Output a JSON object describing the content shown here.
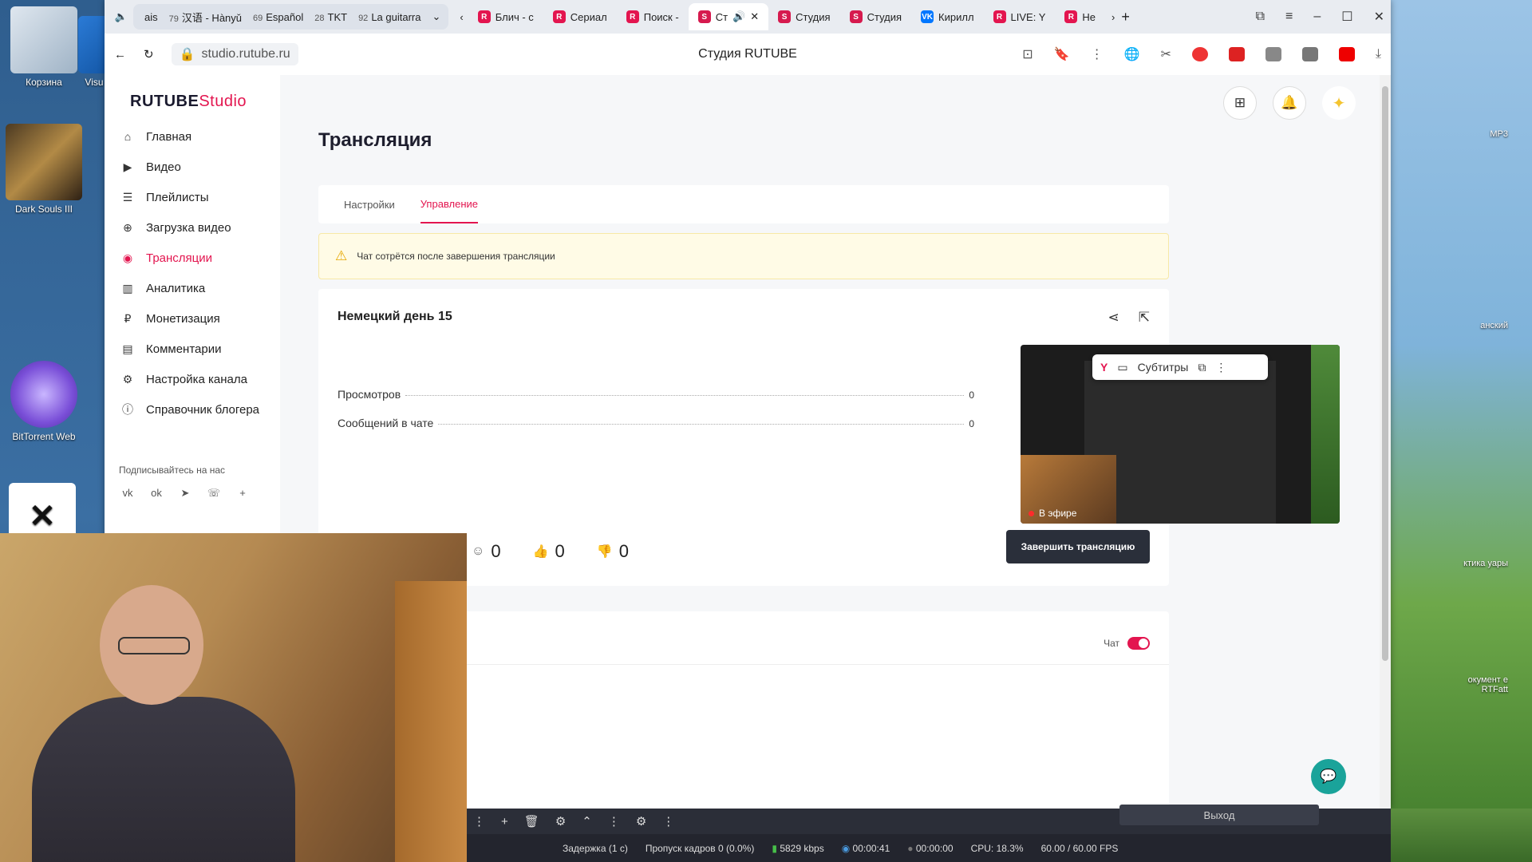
{
  "desktop": {
    "icons_left": [
      {
        "label": "Корзина"
      },
      {
        "label": "Visu"
      },
      {
        "label": "Dark Souls III"
      },
      {
        "label": "BitTorrent Web"
      }
    ],
    "icons_right": [
      {
        "label": "MP3"
      },
      {
        "label": "анский"
      },
      {
        "label": "ктика уары"
      },
      {
        "label": "окумент e RTFatt"
      }
    ]
  },
  "browser": {
    "pinned_tabs": [
      {
        "count": "",
        "label": "ais"
      },
      {
        "count": "79",
        "label": "汉语 - Hànyǔ"
      },
      {
        "count": "69",
        "label": "Español"
      },
      {
        "count": "28",
        "label": "TKT"
      },
      {
        "count": "92",
        "label": "La guitarra"
      }
    ],
    "tabs": [
      {
        "fav": "R",
        "label": "Блич - с"
      },
      {
        "fav": "R",
        "label": "Сериал"
      },
      {
        "fav": "R",
        "label": "Поиск -"
      },
      {
        "fav": "S",
        "label": "Ст",
        "active": true
      },
      {
        "fav": "S",
        "label": "Студия"
      },
      {
        "fav": "S",
        "label": "Студия"
      },
      {
        "fav": "VK",
        "label": "Кирилл"
      },
      {
        "fav": "R",
        "label": "LIVE: Y"
      },
      {
        "fav": "R",
        "label": "Не"
      }
    ],
    "url": "studio.rutube.ru",
    "page_title": "Студия RUTUBE"
  },
  "app": {
    "logo_main": "RUTUBE",
    "logo_accent": "Studio",
    "nav": [
      {
        "label": "Главная",
        "icon": "home-icon"
      },
      {
        "label": "Видео",
        "icon": "video-icon"
      },
      {
        "label": "Плейлисты",
        "icon": "playlist-icon"
      },
      {
        "label": "Загрузка видео",
        "icon": "upload-icon"
      },
      {
        "label": "Трансляции",
        "icon": "broadcast-icon",
        "active": true
      },
      {
        "label": "Аналитика",
        "icon": "analytics-icon"
      },
      {
        "label": "Монетизация",
        "icon": "ruble-icon"
      },
      {
        "label": "Комментарии",
        "icon": "comments-icon"
      },
      {
        "label": "Настройка канала",
        "icon": "gear-icon"
      },
      {
        "label": "Справочник блогера",
        "icon": "help-icon"
      }
    ],
    "follow_label": "Подписывайтесь на нас",
    "heading": "Трансляция",
    "tabs": [
      {
        "label": "Настройки"
      },
      {
        "label": "Управление",
        "active": true
      }
    ],
    "notice": "Чат сотрётся после завершения трансляции",
    "stream": {
      "title": "Немецкий день 15",
      "stats": [
        {
          "label": "Просмотров",
          "value": "0"
        },
        {
          "label": "Сообщений в чате",
          "value": "0"
        }
      ],
      "live_label": "В эфире",
      "subtitles_label": "Субтитры",
      "counters": {
        "viewers": "0",
        "likes": "0",
        "dislikes": "0"
      },
      "end_button": "Завершить трансляцию"
    },
    "chat": {
      "toggle_label": "Чат",
      "enabled": true
    }
  },
  "obs": {
    "exit_label": "Выход",
    "status": {
      "delay": "Задержка (1 с)",
      "dropped": "Пропуск кадров 0 (0.0%)",
      "bitrate": "5829 kbps",
      "stream_time": "00:00:41",
      "record_time": "00:00:00",
      "cpu": "CPU: 18.3%",
      "fps": "60.00 / 60.00 FPS"
    }
  },
  "colors": {
    "accent": "#e3154f",
    "dark_button": "#2a2f3a",
    "notice_bg": "#fffbe6"
  }
}
